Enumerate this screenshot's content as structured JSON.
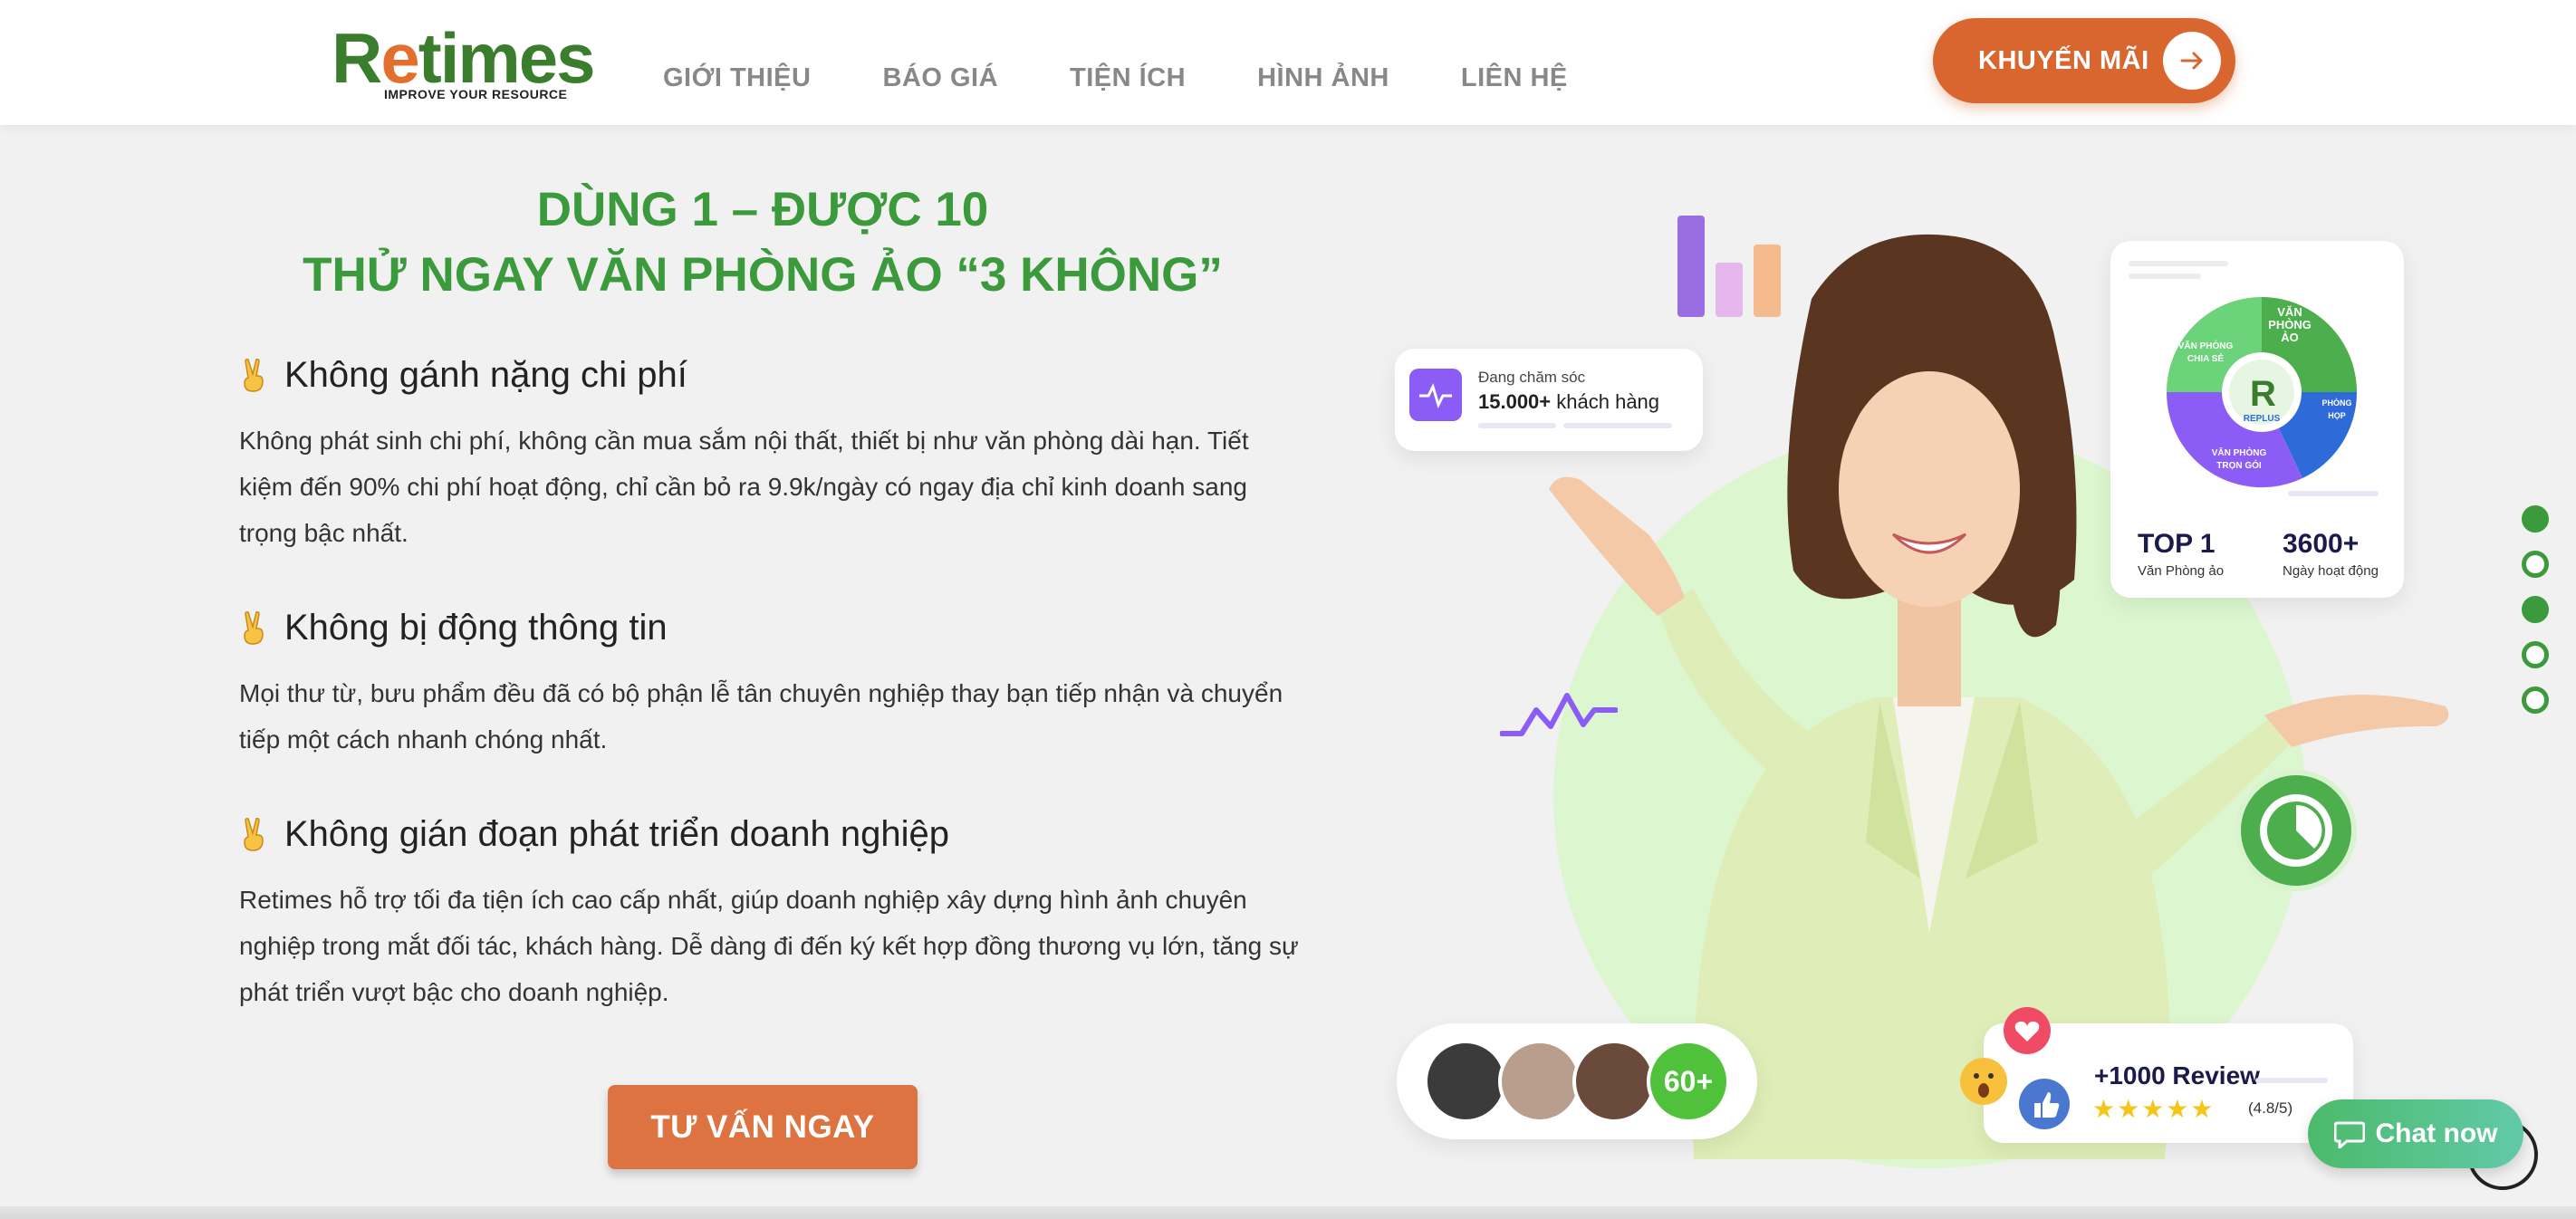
{
  "header": {
    "logo_text_r": "R",
    "logo_text_e": "e",
    "logo_text_rest": "times",
    "logo_tagline": "IMPROVE YOUR RESOURCE",
    "nav": [
      "GIỚI THIỆU",
      "BÁO GIÁ",
      "TIỆN ÍCH",
      "HÌNH ẢNH",
      "LIÊN HỆ"
    ],
    "promo_label": "KHUYẾN MÃI"
  },
  "main": {
    "headline_line1": "DÙNG 1 – ĐƯỢC 10",
    "headline_line2": "THỬ NGAY VĂN PHÒNG ẢO “3 KHÔNG”",
    "features": [
      {
        "title": "Không gánh nặng chi phí",
        "body": "Không phát sinh chi phí, không cần mua sắm nội thất, thiết bị như văn phòng dài hạn. Tiết kiệm đến 90% chi phí hoạt động, chỉ cần bỏ ra 9.9k/ngày có ngay địa chỉ kinh doanh sang trọng bậc nhất."
      },
      {
        "title": "Không bị động thông tin",
        "body": "Mọi thư từ, bưu phẩm đều đã có bộ phận lễ tân chuyên nghiệp thay bạn tiếp nhận và chuyển tiếp một cách nhanh chóng nhất."
      },
      {
        "title": "Không gián đoạn phát triển doanh nghiệp",
        "body": "Retimes hỗ trợ tối đa tiện ích cao cấp nhất, giúp doanh nghiệp xây dựng hình ảnh chuyên nghiệp trong mắt đối tác, khách hàng. Dễ dàng đi đến ký kết hợp đồng thương vụ lớn, tăng sự phát triển vượt bậc cho doanh nghiệp."
      }
    ],
    "cta_label": "TƯ VẤN NGAY"
  },
  "hero": {
    "care_small": "Đang chăm sóc",
    "care_count": "15.000+",
    "care_unit": "khách hàng",
    "pie_labels": [
      "VĂN PHÒNG ẢO",
      "VĂN PHÒNG CHIA SẺ",
      "PHÒNG HỌP",
      "VĂN PHÒNG TRỌN GÓI"
    ],
    "pie_center": "REPLUS",
    "top1": "TOP 1",
    "top1_sub": "Văn Phòng ảo",
    "days": "3600+",
    "days_sub": "Ngày hoạt động",
    "avatars_count": "60+",
    "review_title": "+1000 Review",
    "review_stars": "★★★★★",
    "review_score": "(4.8/5)"
  },
  "side_dots": [
    true,
    false,
    true,
    false,
    false
  ],
  "chat_label": "Chat now",
  "colors": {
    "brand_green": "#3b9a3b",
    "brand_orange": "#d9662e"
  }
}
